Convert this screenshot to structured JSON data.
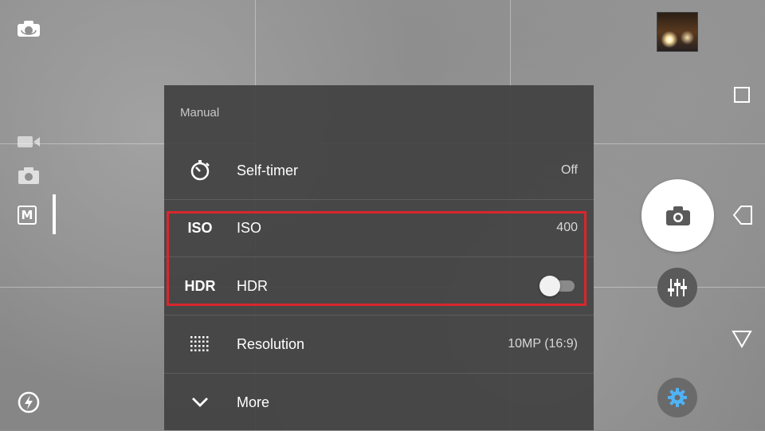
{
  "colors": {
    "panel_bg": "#424242",
    "highlight": "#d9262c",
    "shutter": "#ffffff",
    "settings_accent": "#4fb3f6"
  },
  "left_rail": {
    "switch_camera_icon": "switch-camera-icon",
    "flash_icon": "flash-auto-icon",
    "modes": [
      {
        "name": "video",
        "icon": "video-camera-icon"
      },
      {
        "name": "photo",
        "icon": "camera-icon"
      },
      {
        "name": "manual",
        "label": "M"
      }
    ]
  },
  "right_rail": {
    "thumbnail": "last-photo-thumbnail",
    "shutter_icon": "camera-icon",
    "manual_controls_icon": "sliders-icon",
    "settings_icon": "gear-icon",
    "nav": [
      "recent-apps-icon",
      "back-icon",
      "home-icon"
    ]
  },
  "panel": {
    "title": "Manual",
    "rows": [
      {
        "icon": "self-timer-icon",
        "label": "Self-timer",
        "value": "Off"
      },
      {
        "icon_text": "ISO",
        "label": "ISO",
        "value": "400"
      },
      {
        "icon_text": "HDR",
        "label": "HDR",
        "toggle_on": false
      },
      {
        "icon": "grid-dots-icon",
        "label": "Resolution",
        "value": "10MP (16:9)"
      },
      {
        "icon": "chevron-down-icon",
        "label": "More"
      }
    ]
  }
}
